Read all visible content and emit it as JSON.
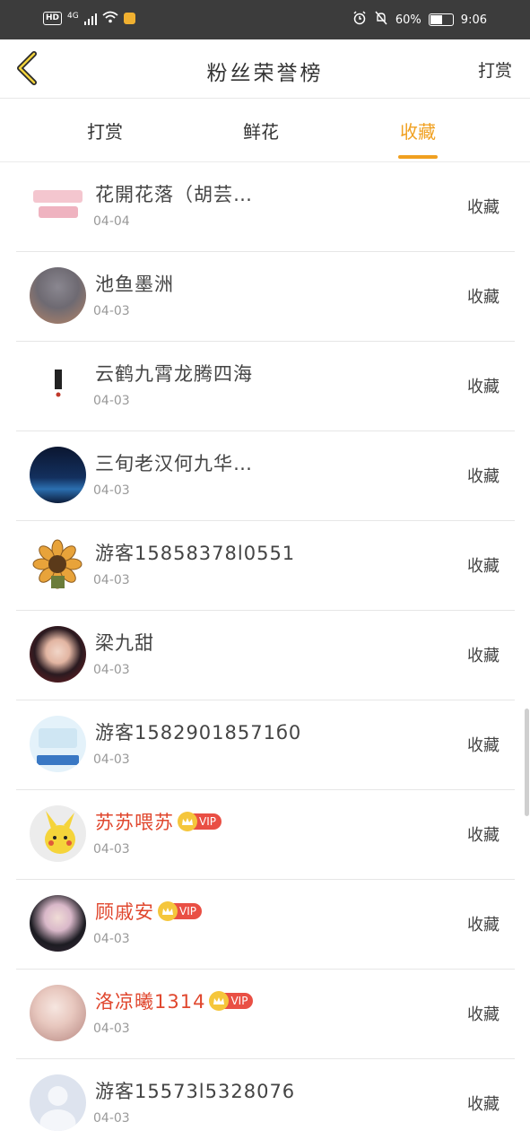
{
  "status_bar": {
    "hd": "HD",
    "network": "4G",
    "battery_text": "60%",
    "battery_level": 0.6,
    "time": "9:06"
  },
  "header": {
    "back_icon": "chevron-left-icon",
    "title": "粉丝荣誉榜",
    "right_action": "打赏"
  },
  "tabs": [
    {
      "label": "打赏",
      "active": false
    },
    {
      "label": "鲜花",
      "active": false
    },
    {
      "label": "收藏",
      "active": true
    }
  ],
  "colors": {
    "accent": "#f0a020",
    "vip_name": "#e0472e",
    "vip_badge": "#e94f44",
    "status_bar_bg": "#3c3c3c"
  },
  "vip_label": "VIP",
  "list": [
    {
      "name": "花開花落（胡芸…",
      "date": "04-04",
      "action": "收藏",
      "vip": false,
      "avatar": "text-logo-avatar"
    },
    {
      "name": "池鱼墨洲",
      "date": "04-03",
      "action": "收藏",
      "vip": false,
      "avatar": "dusk-sky-avatar"
    },
    {
      "name": "云鹤九霄龙腾四海",
      "date": "04-03",
      "action": "收藏",
      "vip": false,
      "avatar": "book-cover-avatar"
    },
    {
      "name": "三旬老汉何九华…",
      "date": "04-03",
      "action": "收藏",
      "vip": false,
      "avatar": "night-sky-avatar"
    },
    {
      "name": "游客15858378l0551",
      "date": "04-03",
      "action": "收藏",
      "vip": false,
      "avatar": "sunflower-avatar"
    },
    {
      "name": "梁九甜",
      "date": "04-03",
      "action": "收藏",
      "vip": false,
      "avatar": "portrait-avatar"
    },
    {
      "name": "游客15829018571б0",
      "date": "04-03",
      "action": "收藏",
      "vip": false,
      "avatar": "study-note-avatar"
    },
    {
      "name": "苏苏喂苏",
      "date": "04-03",
      "action": "收藏",
      "vip": true,
      "avatar": "pikachu-avatar"
    },
    {
      "name": "顾戚安",
      "date": "04-03",
      "action": "收藏",
      "vip": true,
      "avatar": "costume-avatar"
    },
    {
      "name": "洛凉曦1314",
      "date": "04-03",
      "action": "收藏",
      "vip": true,
      "avatar": "girl-avatar"
    },
    {
      "name": "游客15573l5328076",
      "date": "04-03",
      "action": "收藏",
      "vip": false,
      "avatar": "default-user-avatar"
    }
  ]
}
